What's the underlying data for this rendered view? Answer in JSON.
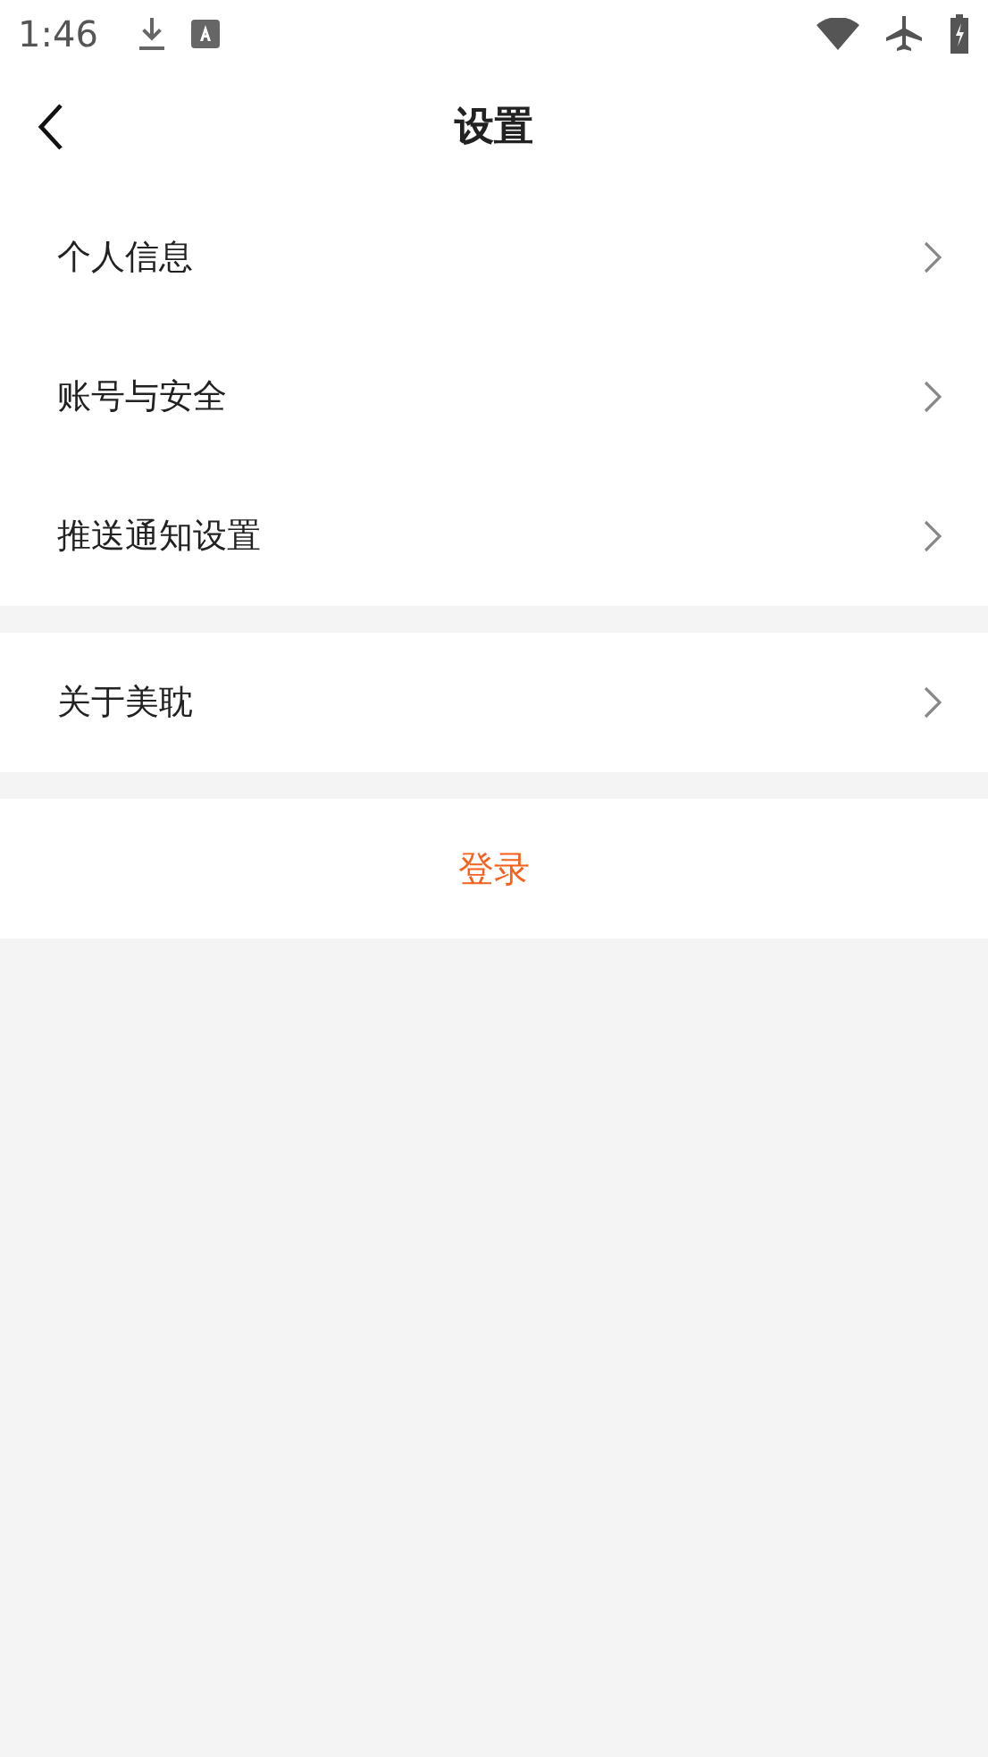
{
  "status_bar": {
    "time": "1:46"
  },
  "header": {
    "title": "设置"
  },
  "groups": [
    {
      "items": [
        {
          "label": "个人信息"
        },
        {
          "label": "账号与安全"
        },
        {
          "label": "推送通知设置"
        }
      ]
    },
    {
      "items": [
        {
          "label": "关于美耽"
        }
      ]
    }
  ],
  "login_button": {
    "label": "登录"
  }
}
